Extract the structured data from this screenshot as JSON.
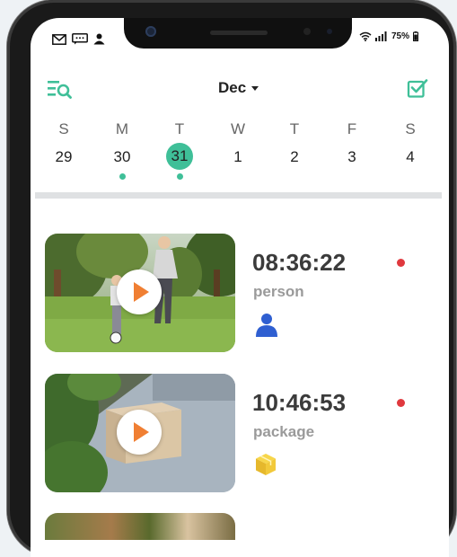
{
  "status_bar": {
    "battery_text": "75%",
    "left_icons": [
      "mail-icon",
      "message-icon",
      "person-icon"
    ],
    "right_icons": [
      "wifi-icon",
      "signal-icon",
      "battery-icon"
    ]
  },
  "header": {
    "month": "Dec",
    "left_icon": "list-search-icon",
    "right_icon": "checkbox-icon",
    "accent_color": "#3fbf98"
  },
  "calendar": {
    "weekdays": [
      "S",
      "M",
      "T",
      "W",
      "T",
      "F",
      "S"
    ],
    "days": [
      "29",
      "30",
      "31",
      "1",
      "2",
      "3",
      "4"
    ],
    "selected_index": 2,
    "days_with_events": [
      1,
      2
    ]
  },
  "events": [
    {
      "time": "08:36:22",
      "label": "person",
      "type_icon": "person-icon",
      "status_color": "#e0393e"
    },
    {
      "time": "10:46:53",
      "label": "package",
      "type_icon": "package-icon",
      "status_color": "#e0393e"
    }
  ]
}
